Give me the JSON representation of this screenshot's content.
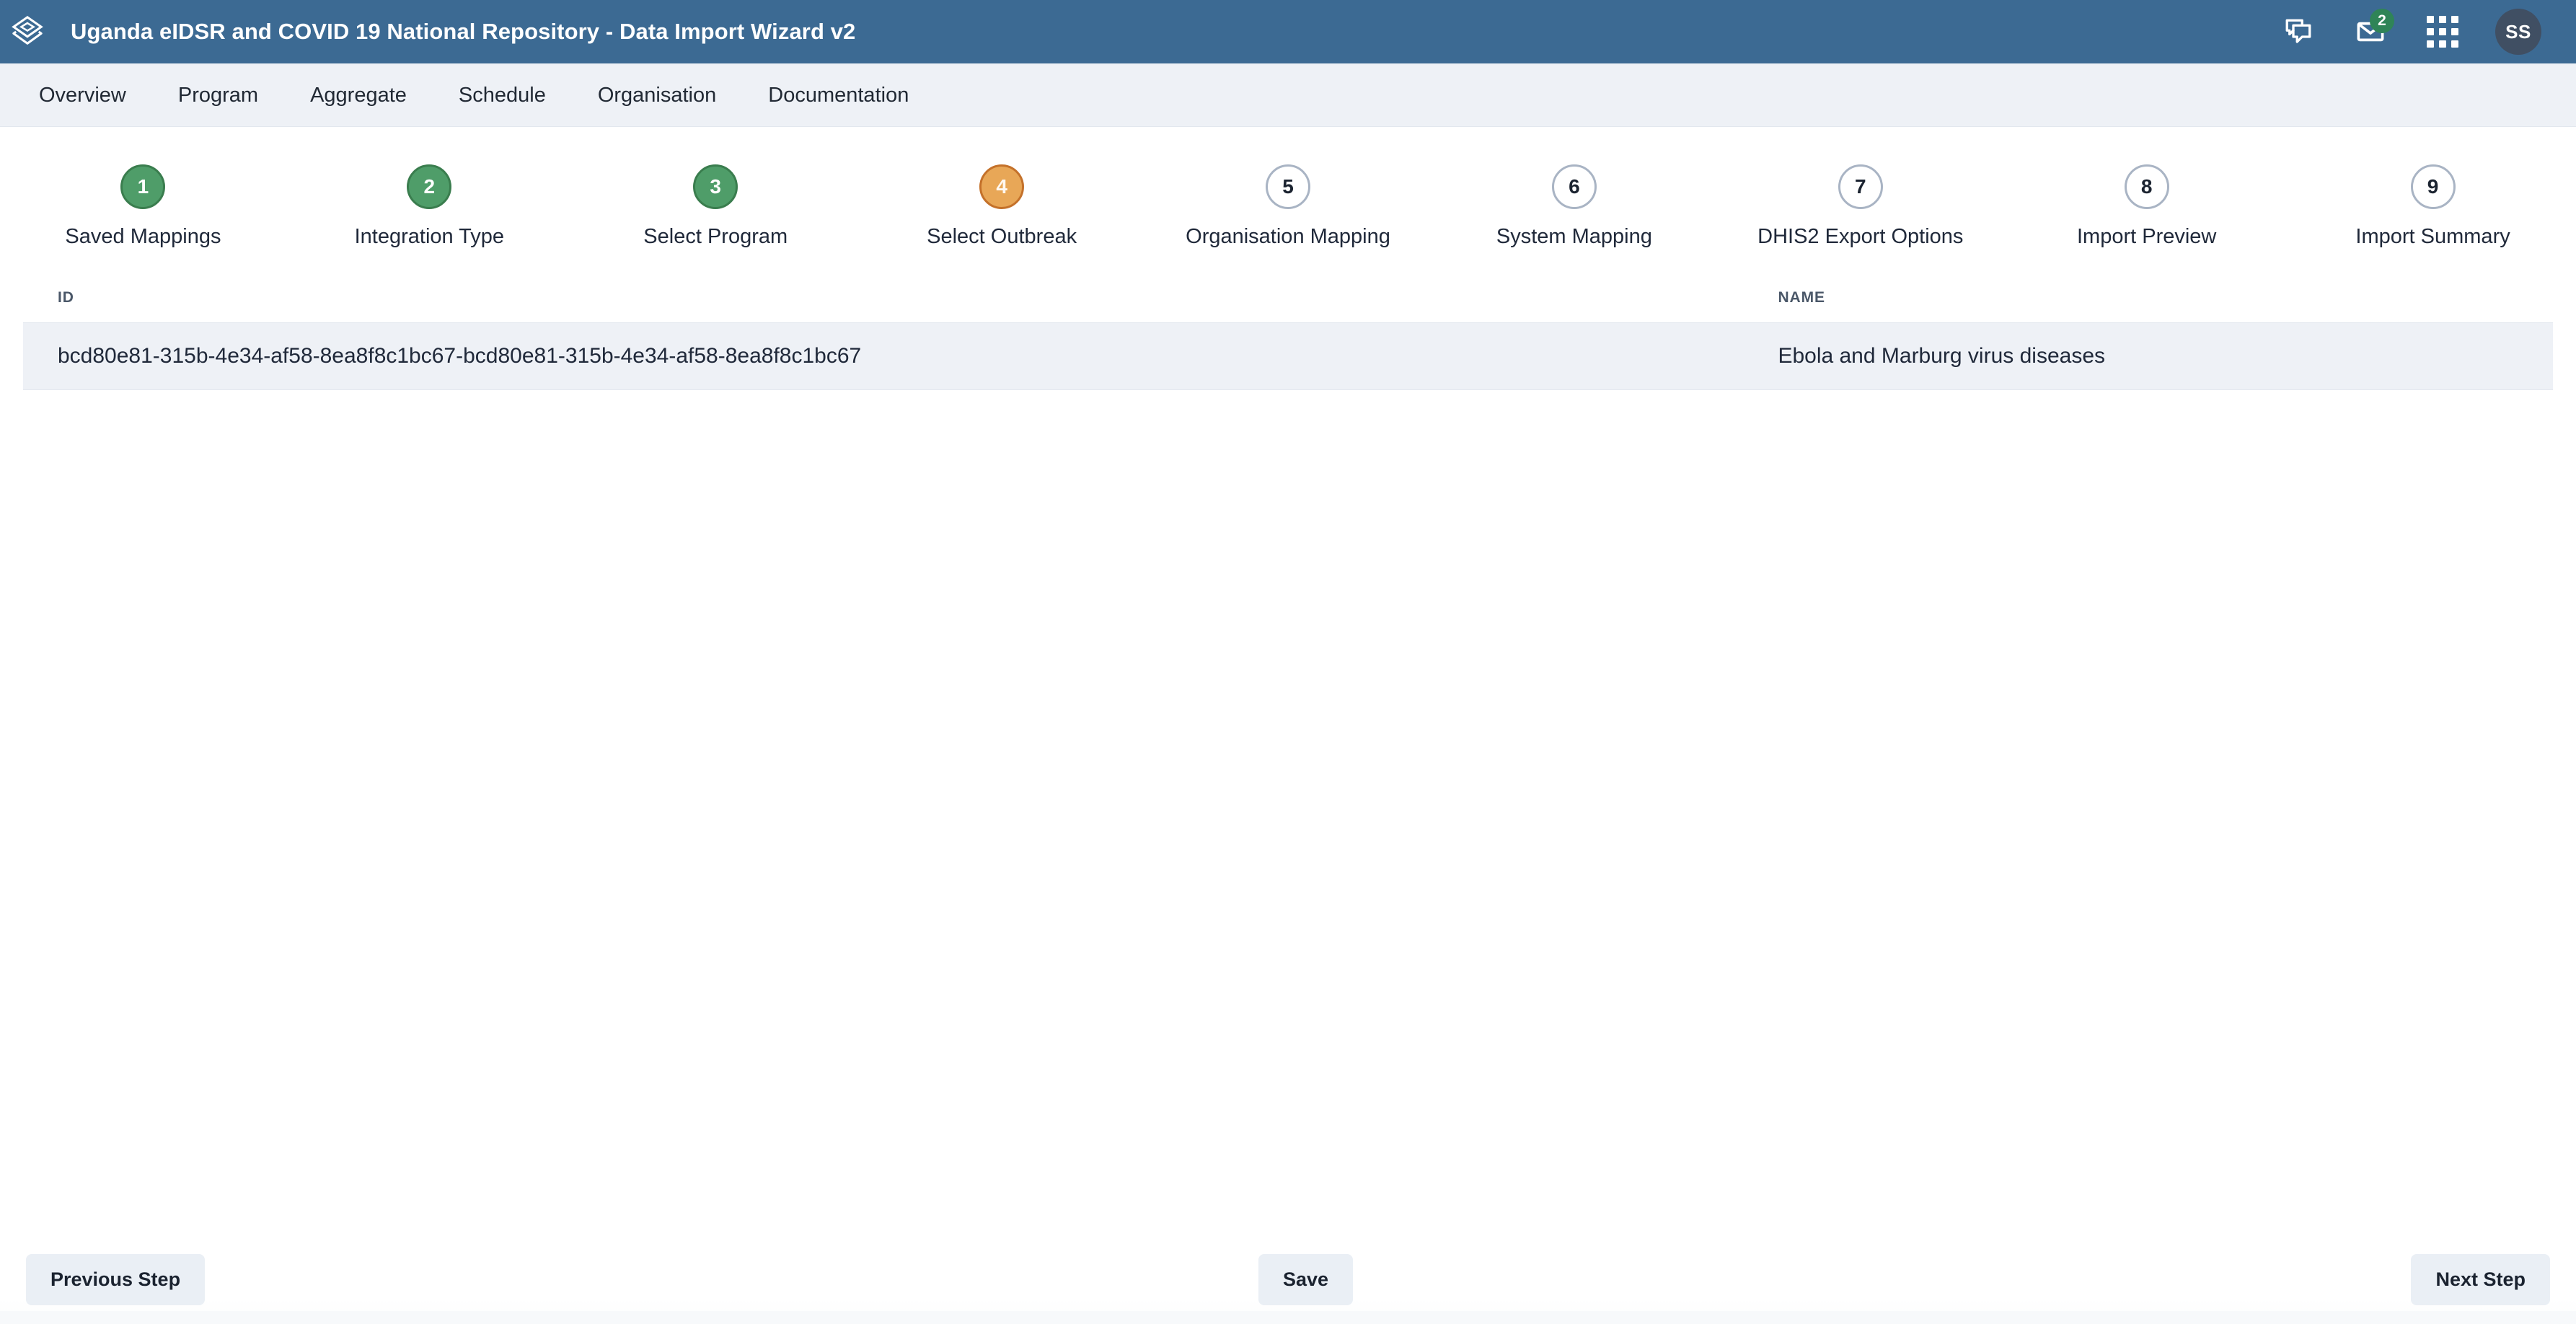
{
  "header": {
    "logo_icon": "dhis2-layers-logo-icon",
    "title": "Uganda eIDSR and COVID 19 National Repository - Data Import Wizard v2",
    "messages_icon": "chat-bubbles-icon",
    "mail_icon": "envelope-icon",
    "mail_badge": "2",
    "apps_icon": "apps-grid-icon",
    "avatar_initials": "SS",
    "background_color": "#3c6a93"
  },
  "nav": {
    "items": [
      {
        "label": "Overview"
      },
      {
        "label": "Program"
      },
      {
        "label": "Aggregate"
      },
      {
        "label": "Schedule"
      },
      {
        "label": "Organisation"
      },
      {
        "label": "Documentation"
      }
    ]
  },
  "stepper": {
    "steps": [
      {
        "number": "1",
        "label": "Saved Mappings",
        "state": "done"
      },
      {
        "number": "2",
        "label": "Integration Type",
        "state": "done"
      },
      {
        "number": "3",
        "label": "Select Program",
        "state": "done"
      },
      {
        "number": "4",
        "label": "Select Outbreak",
        "state": "active"
      },
      {
        "number": "5",
        "label": "Organisation Mapping",
        "state": "todo"
      },
      {
        "number": "6",
        "label": "System Mapping",
        "state": "todo"
      },
      {
        "number": "7",
        "label": "DHIS2 Export Options",
        "state": "todo"
      },
      {
        "number": "8",
        "label": "Import Preview",
        "state": "todo"
      },
      {
        "number": "9",
        "label": "Import Summary",
        "state": "todo"
      }
    ],
    "colors": {
      "done": "#4f9d69",
      "done_border": "#3a7d4e",
      "active": "#e8a757",
      "active_border": "#c4712a",
      "todo_border": "#a9b4c4"
    }
  },
  "table": {
    "columns": [
      {
        "key": "id",
        "header": "ID"
      },
      {
        "key": "name",
        "header": "NAME"
      }
    ],
    "rows": [
      {
        "id": "bcd80e81-315b-4e34-af58-8ea8f8c1bc67-bcd80e81-315b-4e34-af58-8ea8f8c1bc67",
        "name": "Ebola and Marburg virus diseases"
      }
    ],
    "row_background": "#eef1f6"
  },
  "footer": {
    "previous_label": "Previous Step",
    "save_label": "Save",
    "next_label": "Next Step"
  }
}
